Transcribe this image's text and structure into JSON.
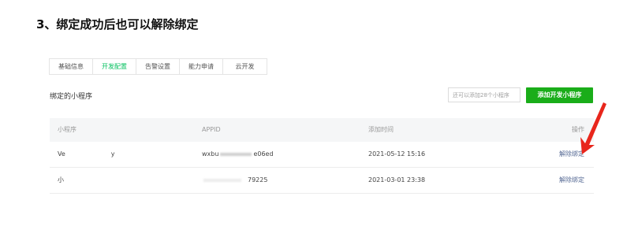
{
  "heading": "3、绑定成功后也可以解除绑定",
  "tabs": [
    {
      "label": "基础信息",
      "active": false
    },
    {
      "label": "开发配置",
      "active": true
    },
    {
      "label": "告警设置",
      "active": false
    },
    {
      "label": "能力申请",
      "active": false
    },
    {
      "label": "云开发",
      "active": false
    }
  ],
  "section": {
    "title": "绑定的小程序",
    "search_placeholder": "还可以添加28个小程序",
    "add_button": "添加开发小程序"
  },
  "table": {
    "headers": {
      "name": "小程序",
      "appid": "APPID",
      "time": "添加时间",
      "action": "操作"
    },
    "rows": [
      {
        "name_start": "Ve",
        "name_end": "y",
        "appid_start": "wxbu",
        "appid_end": "e06ed",
        "time": "2021-05-12 15:16",
        "action": "解除绑定"
      },
      {
        "name_start": "小",
        "name_end": "",
        "appid_start": "",
        "appid_end": "79225",
        "time": "2021-03-01 23:38",
        "action": "解除绑定"
      }
    ]
  },
  "colors": {
    "accent_green": "#1aad19",
    "active_tab": "#07c160",
    "link": "#576b95",
    "arrow": "#e8261c"
  }
}
